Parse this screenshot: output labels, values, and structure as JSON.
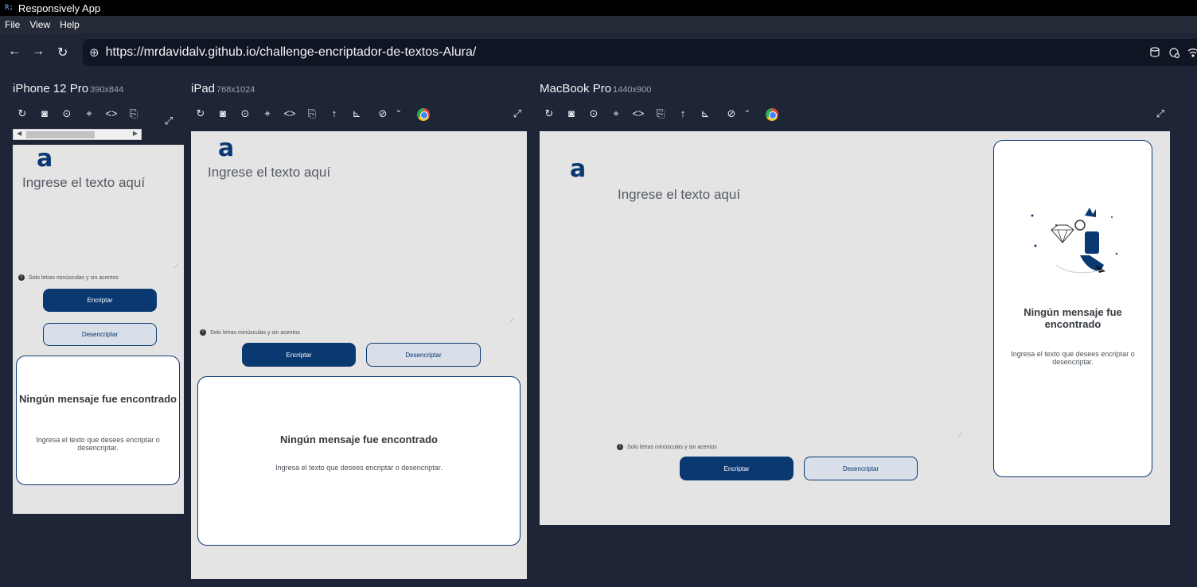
{
  "window": {
    "title": "Responsively App",
    "app_glyph": "R;"
  },
  "menu": [
    "File",
    "View",
    "Help"
  ],
  "address": {
    "url": "https://mrdavidalv.github.io/challenge-encriptador-de-textos-Alura/"
  },
  "nav_icons": {
    "back": "←",
    "forward": "→",
    "reload": "↻",
    "globe": "⊕"
  },
  "devices": {
    "iphone": {
      "name": "iPhone 12 Pro",
      "res": "390x844"
    },
    "ipad": {
      "name": "iPad",
      "res": "768x1024"
    },
    "macbook": {
      "name": "MacBook Pro",
      "res": "1440x900"
    }
  },
  "toolbar_icons": {
    "reload": "↻",
    "screenshot_full": "◙",
    "screenshot": "⊙",
    "inspect": "⌖",
    "code": "<>",
    "rotate": "⎘",
    "scroll_top": "↑",
    "ruler": "⊾",
    "visibility": "⊘",
    "visibility_caret": "⌄",
    "fullscreen": "⤢"
  },
  "app": {
    "logo": "a",
    "placeholder": "Ingrese el texto aquí",
    "hint_icon": "!",
    "hint": "Solo letras minúsculas y sin acentos",
    "encrypt": "Encriptar",
    "decrypt": "Desencriptar",
    "empty_title": "Ningún mensaje fue encontrado",
    "empty_text": "Ingresa el texto que desees encriptar o desencriptar."
  },
  "colors": {
    "brand": "#0a3871",
    "screen_bg": "#e4e4e4",
    "app_bg": "#1d2536"
  }
}
